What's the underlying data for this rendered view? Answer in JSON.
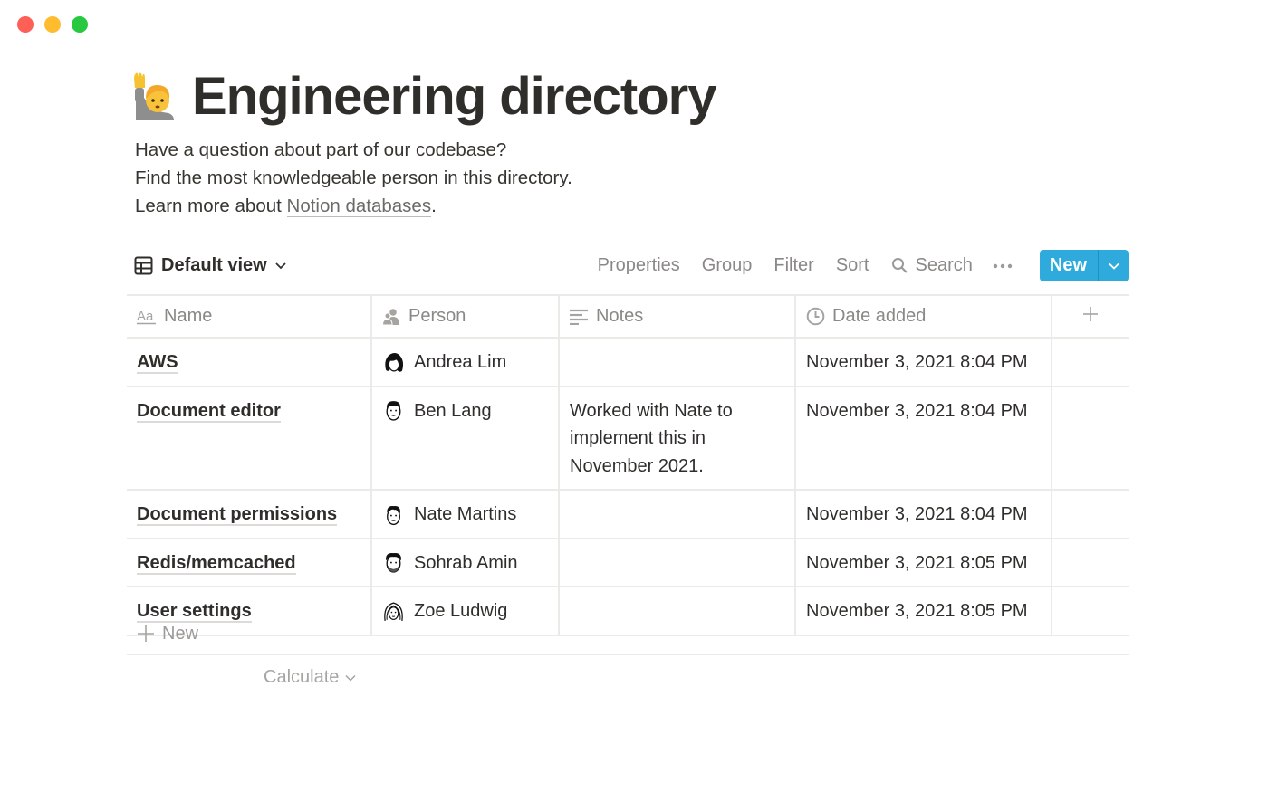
{
  "window": {
    "controls": [
      "close",
      "minimize",
      "maximize"
    ]
  },
  "page": {
    "icon": "person-raising-hand-emoji",
    "title": "Engineering directory",
    "description": {
      "line1": "Have a question about part of our codebase?",
      "line2": "Find the most knowledgeable person in this directory.",
      "line3_prefix": "Learn more about ",
      "line3_link": "Notion databases",
      "line3_suffix": "."
    }
  },
  "toolbar": {
    "view_label": "Default view",
    "properties": "Properties",
    "group": "Group",
    "filter": "Filter",
    "sort": "Sort",
    "search": "Search",
    "more": "•••",
    "new_label": "New",
    "new_color": "#2eaadc"
  },
  "table": {
    "columns": [
      {
        "label": "Name",
        "icon": "text-title-icon"
      },
      {
        "label": "Person",
        "icon": "person-icon"
      },
      {
        "label": "Notes",
        "icon": "text-lines-icon"
      },
      {
        "label": "Date added",
        "icon": "clock-icon"
      }
    ],
    "add_column": "+",
    "rows": [
      {
        "name": "AWS",
        "person": "Andrea Lim",
        "notes": "",
        "date": "November 3, 2021 8:04 PM"
      },
      {
        "name": "Document editor",
        "person": "Ben Lang",
        "notes": "Worked with Nate to implement this in November 2021.",
        "date": "November 3, 2021 8:04 PM"
      },
      {
        "name": "Document permissions",
        "person": "Nate Martins",
        "notes": "",
        "date": "November 3, 2021 8:04 PM"
      },
      {
        "name": "Redis/memcached",
        "person": "Sohrab Amin",
        "notes": "",
        "date": "November 3, 2021 8:05 PM"
      },
      {
        "name": "User settings",
        "person": "Zoe Ludwig",
        "notes": "",
        "date": "November 3, 2021 8:05 PM"
      }
    ],
    "add_row_label": "New",
    "calculate_label": "Calculate"
  }
}
